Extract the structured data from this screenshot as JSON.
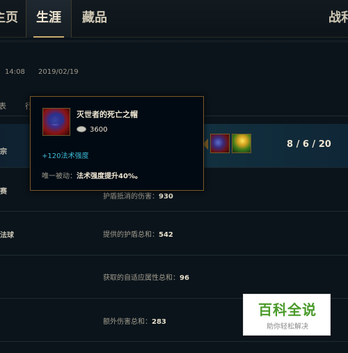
{
  "nav": {
    "home": "主页",
    "career": "生涯",
    "collection": "藏品",
    "battle": "战利"
  },
  "match": {
    "time": "14:08",
    "date": "2019/02/19"
  },
  "tabs": {
    "tab_a": "表",
    "tab_b": "行"
  },
  "player": {
    "kda": "8 / 6 / 20",
    "label_1": "宗",
    "label_2": "赛",
    "label_3": "法球"
  },
  "stats": [
    {
      "label": "护盾抵消的伤害：",
      "value": "930"
    },
    {
      "label": "提供的护盾总和：",
      "value": "542"
    },
    {
      "label": "获取的自适应属性总和：",
      "value": "96"
    },
    {
      "label": "额外伤害总和：",
      "value": "283"
    }
  ],
  "tooltip": {
    "item_name": "灭世者的死亡之帽",
    "price": "3600",
    "stat": "+120法术强度",
    "passive_prefix": "唯一被动：",
    "passive_text": "法术强度提升40%。"
  },
  "watermark": {
    "logo": "百科全说",
    "slogan": "助你轻松解决"
  },
  "colors": {
    "gold": "#c8aa6e",
    "border_gold": "#785a28",
    "stat_blue": "#3dbad6",
    "background": "#0b141b"
  }
}
